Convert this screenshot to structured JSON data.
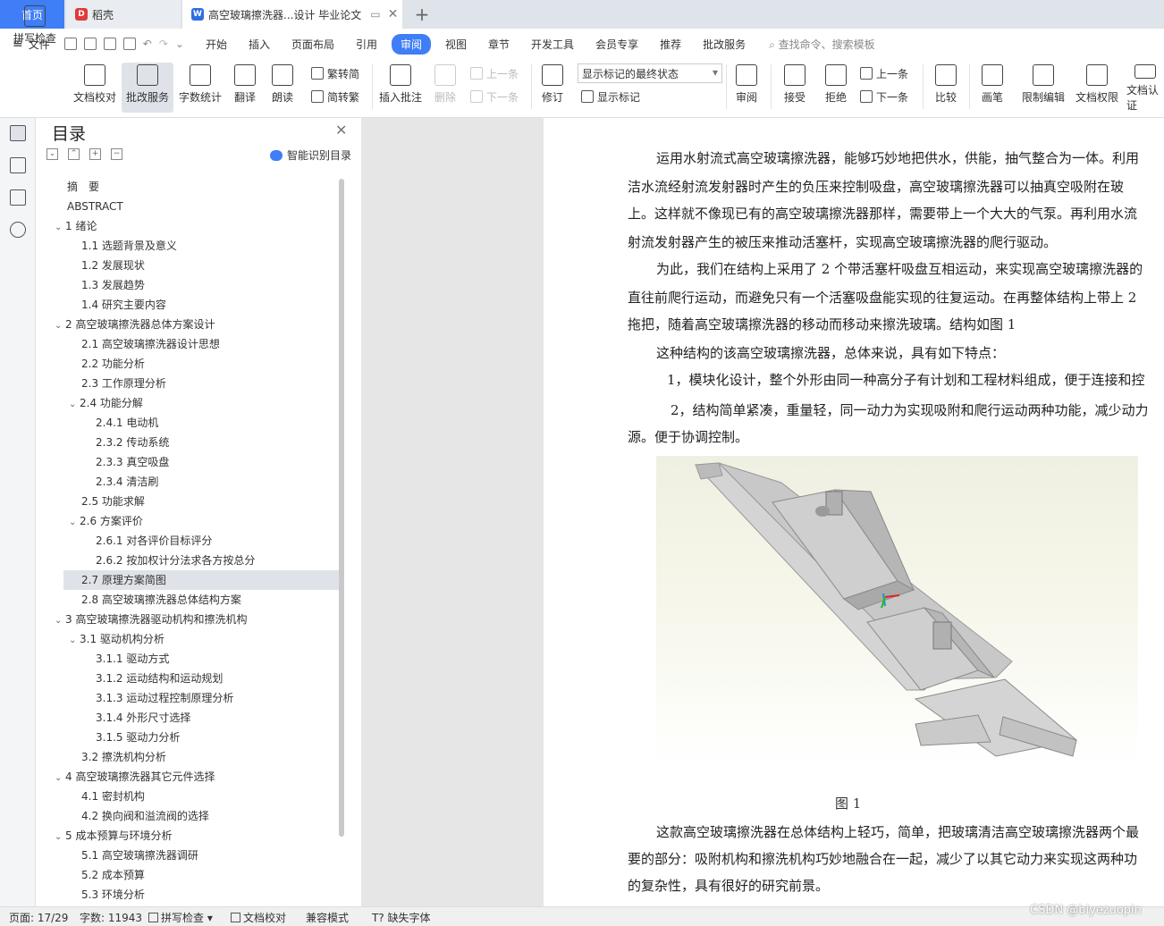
{
  "tabs": {
    "home": "首页",
    "daoke": "稻壳",
    "doc": "高空玻璃擦洗器...设计 毕业论文",
    "add": "+"
  },
  "menu": {
    "file": "文件",
    "items": [
      "开始",
      "插入",
      "页面布局",
      "引用",
      "审阅",
      "视图",
      "章节",
      "开发工具",
      "会员专享",
      "推荐",
      "批改服务"
    ],
    "active": "审阅",
    "search": "查找命令、搜索模板"
  },
  "ribbon": {
    "spell": "拼写检查",
    "proof": "文档校对",
    "grade": "批改服务",
    "wordcount": "字数统计",
    "translate": "翻译",
    "read": "朗读",
    "to_trad": "繁转简",
    "to_simp": "简转繁",
    "insert_comment": "插入批注",
    "delete": "删除",
    "prev": "上一条",
    "next": "下一条",
    "revise": "修订",
    "markup_state": "显示标记的最终状态",
    "show_markup": "显示标记",
    "review": "审阅",
    "accept": "接受",
    "reject": "拒绝",
    "prev2": "上一条",
    "next2": "下一条",
    "compare": "比较",
    "pen": "画笔",
    "restrict": "限制编辑",
    "rights": "文档权限",
    "certify": "文档认证"
  },
  "toc": {
    "title": "目录",
    "smart": "智能识别目录",
    "items": [
      {
        "t": "摘　要",
        "lvl": 0
      },
      {
        "t": "ABSTRACT",
        "lvl": 0
      },
      {
        "t": "1  绪论",
        "lvl": 1,
        "exp": true
      },
      {
        "t": "1.1 选题背景及意义",
        "lvl": 2
      },
      {
        "t": "1.2 发展现状",
        "lvl": 2
      },
      {
        "t": "1.3 发展趋势",
        "lvl": 2
      },
      {
        "t": "1.4 研究主要内容",
        "lvl": 2
      },
      {
        "t": "2  高空玻璃擦洗器总体方案设计",
        "lvl": 1,
        "exp": true
      },
      {
        "t": "2.1  高空玻璃擦洗器设计思想",
        "lvl": 2
      },
      {
        "t": "2.2 功能分析",
        "lvl": 2
      },
      {
        "t": "2.3 工作原理分析",
        "lvl": 2
      },
      {
        "t": "2.4 功能分解",
        "lvl": 2,
        "exp": true
      },
      {
        "t": "2.4.1 电动机",
        "lvl": 3
      },
      {
        "t": "2.3.2 传动系统",
        "lvl": 3
      },
      {
        "t": "2.3.3 真空吸盘",
        "lvl": 3
      },
      {
        "t": "2.3.4  清洁刷",
        "lvl": 3
      },
      {
        "t": "2.5 功能求解",
        "lvl": 2
      },
      {
        "t": "2.6 方案评价",
        "lvl": 2,
        "exp": true
      },
      {
        "t": "2.6.1 对各评价目标评分",
        "lvl": 3
      },
      {
        "t": "2.6.2 按加权计分法求各方按总分",
        "lvl": 3
      },
      {
        "t": "2.7 原理方案简图",
        "lvl": 2,
        "sel": true
      },
      {
        "t": "2.8  高空玻璃擦洗器总体结构方案",
        "lvl": 2
      },
      {
        "t": "3  高空玻璃擦洗器驱动机构和擦洗机构",
        "lvl": 1,
        "exp": true
      },
      {
        "t": "3.1  驱动机构分析",
        "lvl": 2,
        "exp": true
      },
      {
        "t": "3.1.1  驱动方式",
        "lvl": 3
      },
      {
        "t": "3.1.2 运动结构和运动规划",
        "lvl": 3
      },
      {
        "t": "3.1.3 运动过程控制原理分析",
        "lvl": 3
      },
      {
        "t": "3.1.4 外形尺寸选择",
        "lvl": 3
      },
      {
        "t": "3.1.5 驱动力分析",
        "lvl": 3
      },
      {
        "t": "3.2 擦洗机构分析",
        "lvl": 2
      },
      {
        "t": "4  高空玻璃擦洗器其它元件选择",
        "lvl": 1,
        "exp": true
      },
      {
        "t": "4.1 密封机构",
        "lvl": 2
      },
      {
        "t": "4.2 换向阀和溢流阀的选择",
        "lvl": 2
      },
      {
        "t": "5  成本预算与环境分析",
        "lvl": 1,
        "exp": true
      },
      {
        "t": "5.1  高空玻璃擦洗器调研",
        "lvl": 2
      },
      {
        "t": "5.2  成本预算",
        "lvl": 2
      },
      {
        "t": "5.3  环境分析",
        "lvl": 2
      }
    ]
  },
  "doc": {
    "lines": [
      "运用水射流式高空玻璃擦洗器，能够巧妙地把供水，供能，抽气整合为一体。利用",
      "洁水流经射流发射器时产生的负压来控制吸盘，高空玻璃擦洗器可以抽真空吸附在玻",
      "上。这样就不像现已有的高空玻璃擦洗器那样，需要带上一个大大的气泵。再利用水流",
      "射流发射器产生的被压来推动活塞杆，实现高空玻璃擦洗器的爬行驱动。",
      "为此，我们在结构上采用了 2 个带活塞杆吸盘互相运动，来实现高空玻璃擦洗器的",
      "直往前爬行运动，而避免只有一个活塞吸盘能实现的往复运动。在再整体结构上带上 2",
      "拖把，随着高空玻璃擦洗器的移动而移动来擦洗玻璃。结构如图 1",
      "这种结构的该高空玻璃擦洗器，总体来说，具有如下特点：",
      "1，模块化设计，整个外形由同一种高分子有计划和工程材料组成，便于连接和控",
      "2，结构简单紧凑，重量轻，同一动力为实现吸附和爬行运动两种功能，减少动力",
      "源。便于协调控制。"
    ],
    "caption": "图 1",
    "after": [
      "这款高空玻璃擦洗器在总体结构上轻巧，简单，把玻璃清洁高空玻璃擦洗器两个最",
      "要的部分：吸附机构和擦洗机构巧妙地融合在一起，减少了以其它动力来实现这两种功",
      "的复杂性，具有很好的研究前景。"
    ]
  },
  "status": {
    "page": "页面: 17/29",
    "words": "字数: 11943",
    "spell": "拼写检查",
    "proof": "文档校对",
    "compat": "兼容模式",
    "font": "缺失字体"
  },
  "watermark": "CSDN @biyezuopin"
}
